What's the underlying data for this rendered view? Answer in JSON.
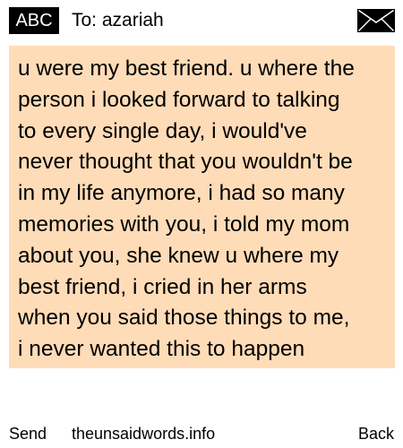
{
  "header": {
    "input_mode": "ABC",
    "recipient_line": "To: azariah",
    "envelope_icon": "envelope-icon"
  },
  "message": {
    "lines": [
      "u were my best friend. u where the",
      "person i looked forward to talking",
      "to every single day, i would've",
      "never thought that you wouldn't be",
      "in my life anymore, i had so many",
      "memories with you, i told my mom",
      "about you, she knew u where my",
      "best friend, i cried in her arms",
      "when you said those things to me,",
      "i never wanted this to happen"
    ],
    "background_color": "#ffdcb8"
  },
  "footer": {
    "send_label": "Send",
    "site_label": "theunsaidwords.info",
    "back_label": "Back"
  }
}
